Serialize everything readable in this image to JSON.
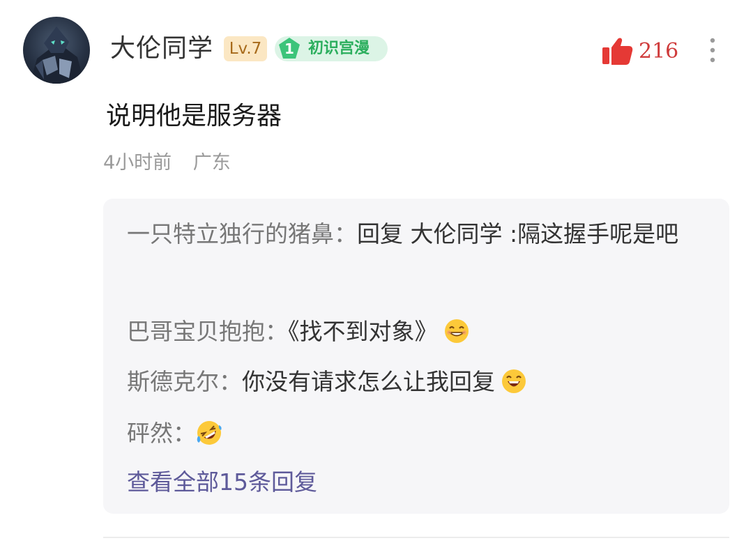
{
  "comment": {
    "user": {
      "name": "大伦同学",
      "level": "Lv.7",
      "fan_level": "1",
      "fan_title": "初识宫漫"
    },
    "likes": "216",
    "text": "说明他是服务器",
    "time": "4小时前",
    "location": "广东",
    "replies": [
      {
        "author": "一只特立独行的猪鼻：",
        "text": "回复 大伦同学 :隔这握手呢是吧",
        "emoji": ""
      },
      {
        "author": "巴哥宝贝抱抱：",
        "text": "《找不到对象》",
        "emoji": "grin-emoji"
      },
      {
        "author": "斯德克尔：",
        "text": "你没有请求怎么让我回复",
        "emoji": "laugh-emoji"
      },
      {
        "author": "砰然：",
        "text": "",
        "emoji": "rofl-emoji"
      }
    ],
    "view_all": "查看全部15条回复"
  },
  "colors": {
    "like": "#e53935",
    "level_badge_bg": "#fbe7c3",
    "fan_badge_bg": "#dcf4e6",
    "fan_green": "#2bae5d",
    "view_all": "#5e5a9a"
  }
}
